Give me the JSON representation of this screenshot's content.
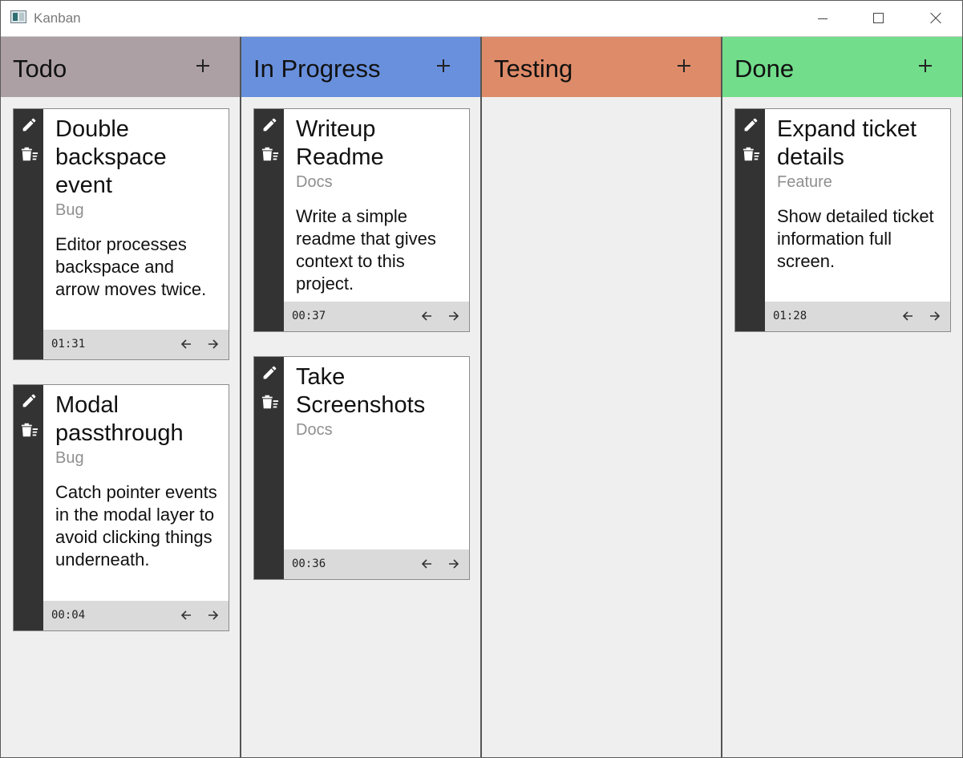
{
  "window": {
    "title": "Kanban"
  },
  "columns": [
    {
      "title": "Todo",
      "color": "#aca0a5",
      "cards": [
        {
          "title": "Double backspace event",
          "tag": "Bug",
          "description": "Editor processes backspace and arrow moves twice.",
          "time": "01:31"
        },
        {
          "title": "Modal passthrough",
          "tag": "Bug",
          "description": "Catch pointer events in the modal layer to avoid clicking things underneath.",
          "time": "00:04"
        }
      ]
    },
    {
      "title": "In Progress",
      "color": "#6990dc",
      "cards": [
        {
          "title": "Writeup Readme",
          "tag": "Docs",
          "description": "Write a simple readme that gives context to this project.",
          "time": "00:37"
        },
        {
          "title": "Take Screenshots",
          "tag": "Docs",
          "description": "",
          "time": "00:36"
        }
      ]
    },
    {
      "title": "Testing",
      "color": "#de8b69",
      "cards": []
    },
    {
      "title": "Done",
      "color": "#72dd8b",
      "cards": [
        {
          "title": "Expand ticket details",
          "tag": "Feature",
          "description": "Show detailed ticket information full screen.",
          "time": "01:28"
        }
      ]
    }
  ],
  "icons": {
    "edit": "pencil-icon",
    "delete": "trash-icon",
    "move_left": "arrow-left-icon",
    "move_right": "arrow-right-icon",
    "add": "plus-icon"
  }
}
